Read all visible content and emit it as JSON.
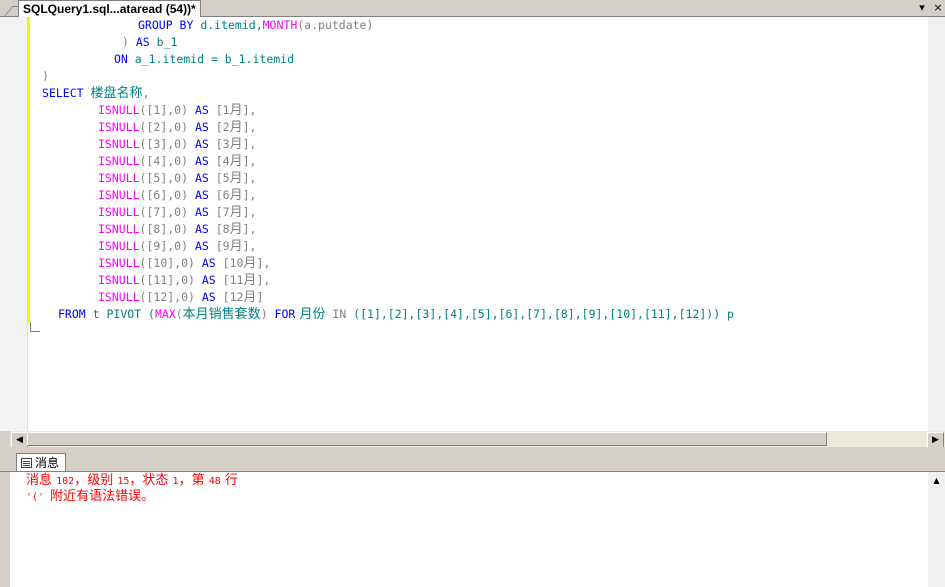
{
  "tab": {
    "title": "SQLQuery1.sql...ataread (54))*"
  },
  "tab_buttons": {
    "pin": "▾",
    "close": "×"
  },
  "code": {
    "l1": {
      "a": "GROUP BY ",
      "b": "d.itemid,",
      "c": "MONTH",
      "d": "(a.putdate)"
    },
    "l2": {
      "a": ") ",
      "b": "AS",
      "c": " b_1"
    },
    "l3": {
      "a": "ON",
      "b": " a_1.itemid = b_1.itemid"
    },
    "l4": ")",
    "l5": {
      "a": "SELECT",
      "b": "楼盘名称",
      "c": ","
    },
    "isnull_rows": [
      {
        "fn": "ISNULL",
        "args": "([1],0) ",
        "as": "AS",
        "open": " [1",
        "month": "月",
        "end": "],"
      },
      {
        "fn": "ISNULL",
        "args": "([2],0) ",
        "as": "AS",
        "open": " [2",
        "month": "月",
        "end": "],"
      },
      {
        "fn": "ISNULL",
        "args": "([3],0) ",
        "as": "AS",
        "open": " [3",
        "month": "月",
        "end": "],"
      },
      {
        "fn": "ISNULL",
        "args": "([4],0) ",
        "as": "AS",
        "open": " [4",
        "month": "月",
        "end": "],"
      },
      {
        "fn": "ISNULL",
        "args": "([5],0) ",
        "as": "AS",
        "open": " [5",
        "month": "月",
        "end": "],"
      },
      {
        "fn": "ISNULL",
        "args": "([6],0) ",
        "as": "AS",
        "open": " [6",
        "month": "月",
        "end": "],"
      },
      {
        "fn": "ISNULL",
        "args": "([7],0) ",
        "as": "AS",
        "open": " [7",
        "month": "月",
        "end": "],"
      },
      {
        "fn": "ISNULL",
        "args": "([8],0) ",
        "as": "AS",
        "open": " [8",
        "month": "月",
        "end": "],"
      },
      {
        "fn": "ISNULL",
        "args": "([9],0) ",
        "as": "AS",
        "open": " [9",
        "month": "月",
        "end": "],"
      },
      {
        "fn": "ISNULL",
        "args": "([10],0) ",
        "as": "AS",
        "open": " [10",
        "month": "月",
        "end": "],"
      },
      {
        "fn": "ISNULL",
        "args": "([11],0) ",
        "as": "AS",
        "open": " [11",
        "month": "月",
        "end": "],"
      },
      {
        "fn": "ISNULL",
        "args": "([12],0) ",
        "as": "AS",
        "open": " [12",
        "month": "月",
        "end": "]"
      }
    ],
    "last": {
      "from": "FROM",
      "t": " t PIVOT (",
      "max": "MAX",
      "paren": "(",
      "col": "本月销售套数",
      "close": ") ",
      "for": "FOR",
      "yue": " 月份",
      "in": " IN",
      "list": " ([1],[2],[3],[4],[5],[6],[7],[8],[9],[10],[11],[12])) p"
    }
  },
  "results_tab": {
    "label": "消息"
  },
  "messages": {
    "line1": {
      "a": "消息 ",
      "n1": "102",
      "b": "，级别 ",
      "n2": "15",
      "c": "，状态 ",
      "n3": "1",
      "d": "，第 ",
      "n4": "48",
      "e": " 行"
    },
    "line2": {
      "a": "'(' ",
      "b": "附近有语法错误。"
    }
  },
  "colors": {
    "keyword": "#0000ff",
    "function": "#ff00ff",
    "identifier": "#008080",
    "operator": "#808080",
    "error": "#ff0000",
    "changebar": "#fff200"
  }
}
